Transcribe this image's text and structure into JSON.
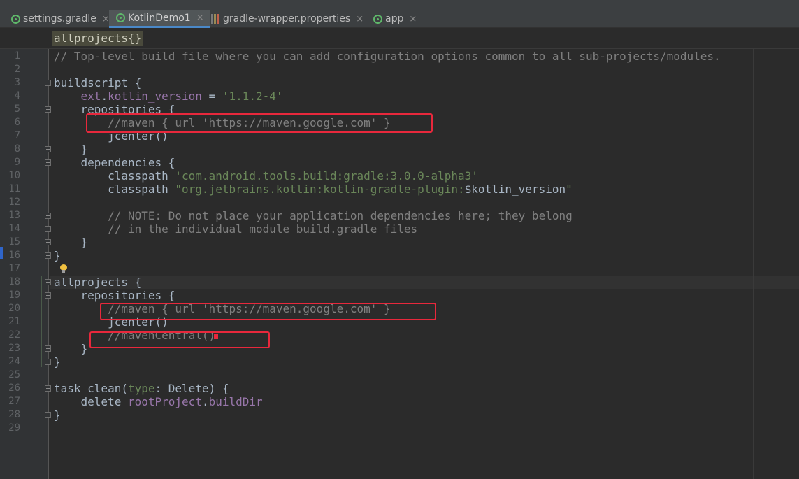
{
  "tabs": [
    {
      "label": "settings.gradle",
      "icon": "gradle-icon",
      "active": false
    },
    {
      "label": "KotlinDemo1",
      "icon": "gradle-icon",
      "active": true
    },
    {
      "label": "gradle-wrapper.properties",
      "icon": "properties-file-icon",
      "active": false
    },
    {
      "label": "app",
      "icon": "gradle-icon",
      "active": false
    }
  ],
  "tab_close": "×",
  "breadcrumb": "allprojects{}",
  "line_numbers": [
    "1",
    "2",
    "3",
    "4",
    "5",
    "6",
    "7",
    "8",
    "9",
    "10",
    "11",
    "12",
    "13",
    "14",
    "15",
    "16",
    "17",
    "18",
    "19",
    "20",
    "21",
    "22",
    "23",
    "24",
    "25",
    "26",
    "27",
    "28",
    "29"
  ],
  "code": {
    "l1": "// Top-level build file where you can add configuration options common to all sub-projects/modules.",
    "l3a": "buildscript {",
    "l4a": "    ",
    "l4b": "ext",
    "l4c": ".",
    "l4d": "kotlin_version",
    "l4e": " = ",
    "l4f": "'1.1.2-4'",
    "l5": "    repositories {",
    "l6": "        //maven { url 'https://maven.google.com' }",
    "l7": "        jcenter()",
    "l8": "    }",
    "l9": "    dependencies {",
    "l10a": "        classpath ",
    "l10b": "'com.android.tools.build:gradle:3.0.0-alpha3'",
    "l11a": "        classpath ",
    "l11b": "\"org.jetbrains.kotlin:kotlin-gradle-plugin:",
    "l11c": "$kotlin_version",
    "l11d": "\"",
    "l13": "        // NOTE: Do not place your application dependencies here; they belong",
    "l14": "        // in the individual module build.gradle files",
    "l15": "    }",
    "l16": "}",
    "l18": "allprojects {",
    "l19": "    repositories {",
    "l20": "        //maven { url 'https://maven.google.com' }",
    "l21": "        jcenter()",
    "l22": "        //mavenCentral()",
    "l23": "    }",
    "l24": "}",
    "l26a": "task clean(",
    "l26b": "type",
    "l26c": ": Delete) {",
    "l27a": "    delete ",
    "l27b": "rootProject",
    "l27c": ".",
    "l27d": "buildDir",
    "l28": "}"
  },
  "colors": {
    "comment": "#808080",
    "string": "#6a8759",
    "property": "#9876aa",
    "keyword": "#cc7832",
    "highlight_box": "#e8283c"
  }
}
